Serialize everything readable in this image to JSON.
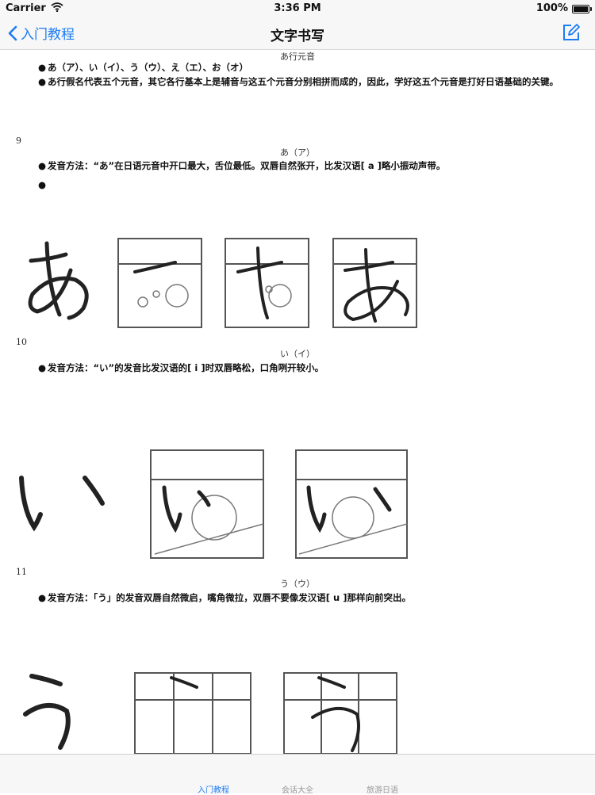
{
  "status_bar": {
    "carrier": "Carrier",
    "time": "3:36 PM",
    "battery": "100%"
  },
  "nav": {
    "back_label": "入门教程",
    "title": "文字书写"
  },
  "content": {
    "section_title": "あ行元音",
    "intro_bullets": [
      "あ（ア）、い（イ）、う（ウ）、え（エ）、お（オ）",
      "あ行假名代表五个元音，其它各行基本上是辅音与这五个元音分别相拼而成的，因此，学好这五个元音是打好日语基础的关键。"
    ],
    "lessons": [
      {
        "page": "9",
        "kana": "あ（ア）",
        "bullets": [
          "发音方法：“あ”在日语元音中开口最大，舌位最低。双唇自然张开，比发汉语[ a ]略小振动声带。",
          ""
        ]
      },
      {
        "page": "10",
        "kana": "い（イ）",
        "bullets": [
          "发音方法：“い”的发音比发汉语的[ i ]时双唇略松，口角咧开较小。"
        ]
      },
      {
        "page": "11",
        "kana": "う（ウ）",
        "bullets": [
          "发音方法：「う」的发音双唇自然微启，嘴角微拉，双唇不要像发汉语[ u ]那样向前突出。"
        ]
      }
    ]
  },
  "tabs": [
    {
      "label": "入门教程",
      "active": true
    },
    {
      "label": "会话大全",
      "active": false
    },
    {
      "label": "旅游日语",
      "active": false
    }
  ],
  "colors": {
    "accent": "#1d7cf2",
    "bar_bg": "#f7f7f7"
  },
  "icons": {
    "back": "chevron-left-icon",
    "edit": "compose-icon",
    "wifi": "wifi-icon",
    "battery": "battery-icon"
  }
}
